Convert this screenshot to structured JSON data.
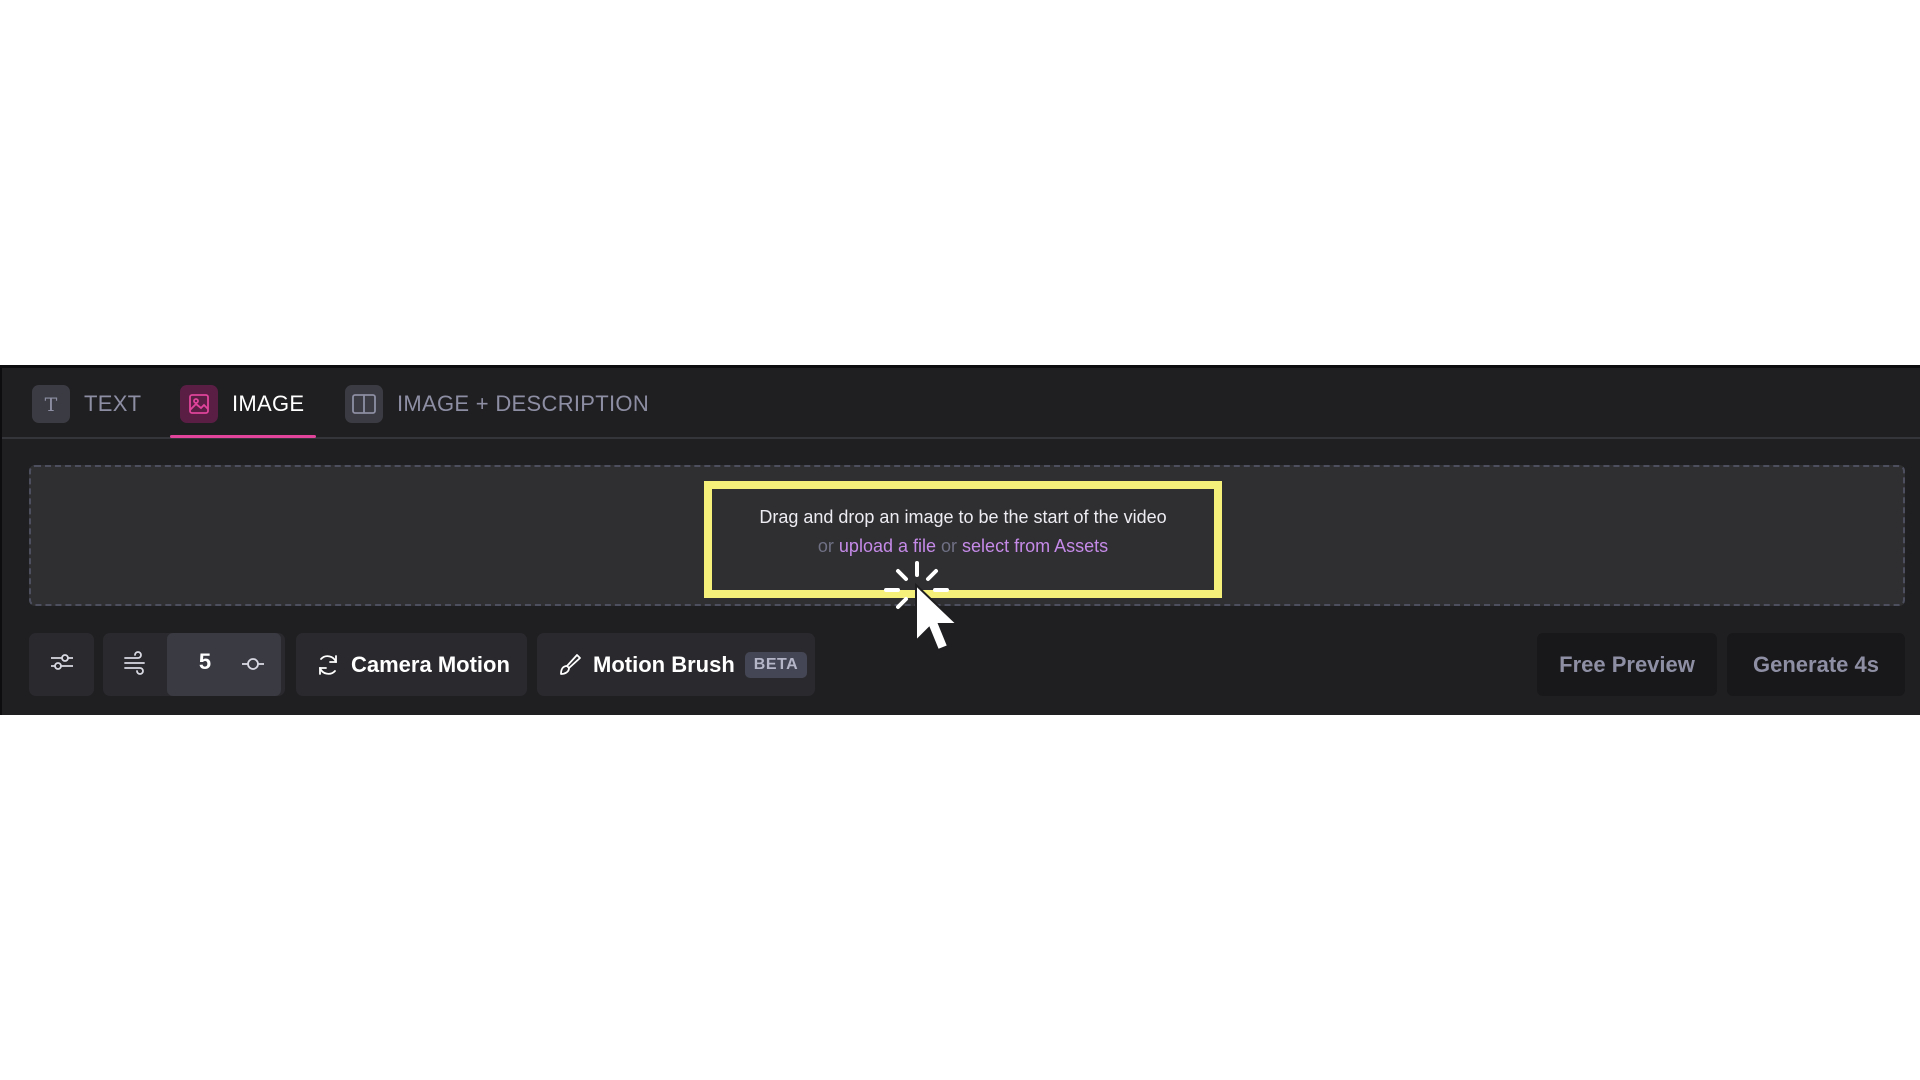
{
  "tabs": [
    {
      "label": "TEXT",
      "icon": "text-t-icon",
      "active": false
    },
    {
      "label": "IMAGE",
      "icon": "image-icon",
      "active": true
    },
    {
      "label": "IMAGE + DESCRIPTION",
      "icon": "split-layout-icon",
      "active": false
    }
  ],
  "dropzone": {
    "main_text": "Drag and drop an image to be the start of the video",
    "or_1": "or",
    "upload_link": "upload a file",
    "or_2": "or",
    "assets_link": "select from Assets"
  },
  "toolbar": {
    "settings_icon": "sliders-icon",
    "motion_icon": "wind-icon",
    "motion_value": "5",
    "motion_slider_icon": "slider-knob-icon",
    "camera_motion_label": "Camera Motion",
    "camera_icon": "camera-rotate-icon",
    "motion_brush_label": "Motion Brush",
    "brush_icon": "paint-brush-icon",
    "beta_badge": "BETA",
    "free_preview_label": "Free Preview",
    "generate_label": "Generate 4s"
  },
  "colors": {
    "accent": "#e0449b",
    "link": "#c58ae8",
    "highlight": "#f5f07a",
    "panel_bg": "#1f1f22"
  }
}
